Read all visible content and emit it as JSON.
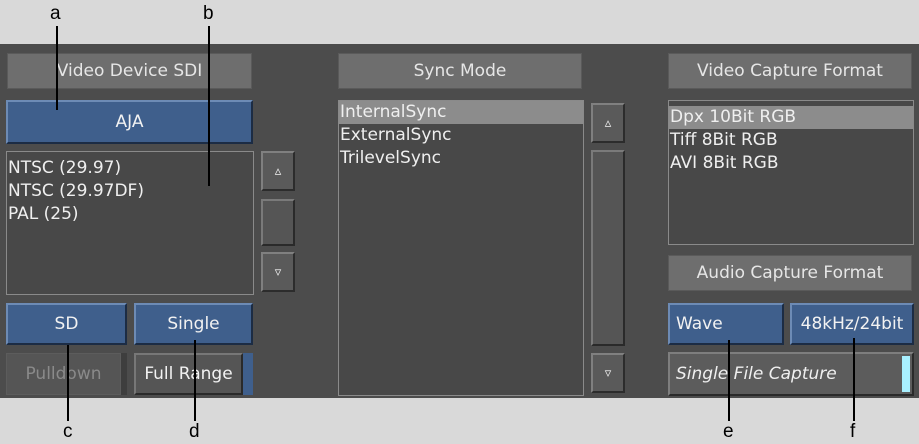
{
  "callouts": {
    "a": "a",
    "b": "b",
    "c": "c",
    "d": "d",
    "e": "e",
    "f": "f"
  },
  "video_device": {
    "header": "Video Device SDI",
    "device_button": "AJA",
    "formats": [
      "NTSC (29.97)",
      "NTSC (29.97DF)",
      "PAL (25)"
    ],
    "definition_button": "SD",
    "field_button": "Single",
    "pulldown_button": "Pulldown",
    "range_button": "Full Range",
    "scroll_up": "▵",
    "scroll_down": "▿"
  },
  "sync_mode": {
    "header": "Sync Mode",
    "items": [
      "InternalSync",
      "ExternalSync",
      "TrilevelSync"
    ],
    "selected_index": 0,
    "scroll_up": "▵",
    "scroll_down": "▿"
  },
  "video_capture_format": {
    "header": "Video Capture Format",
    "items": [
      "Dpx 10Bit RGB",
      "Tiff 8Bit RGB",
      "AVI 8Bit RGB"
    ],
    "selected_index": 0
  },
  "audio_capture_format": {
    "header": "Audio Capture Format",
    "type_button": "Wave",
    "rate_button": "48kHz/24bit",
    "single_file_capture": "Single File Capture"
  },
  "colors": {
    "panel": "#4c4c4c",
    "button_blue": "#3f5f8c",
    "selection": "#8c8c8c",
    "toggle_indicator": "#a8f0ff"
  }
}
